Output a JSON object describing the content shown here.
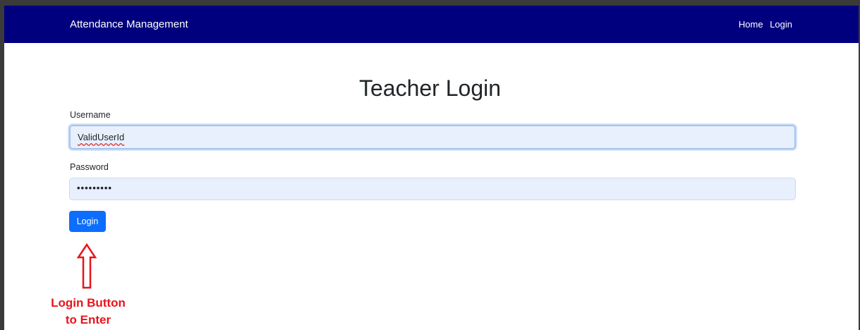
{
  "navbar": {
    "brand": "Attendance Management",
    "links": [
      "Home",
      "Login"
    ],
    "background_color": "#00007f"
  },
  "page": {
    "title": "Teacher Login"
  },
  "form": {
    "username_label": "Username",
    "username_value": "ValidUserId",
    "password_label": "Password",
    "password_value": "•••••••••",
    "login_button_label": "Login",
    "button_color": "#0d6efd"
  },
  "annotation": {
    "line1": "Login Button",
    "line2": "to Enter",
    "color": "#e8141b",
    "arrow_icon": "up-arrow-outline-icon"
  }
}
